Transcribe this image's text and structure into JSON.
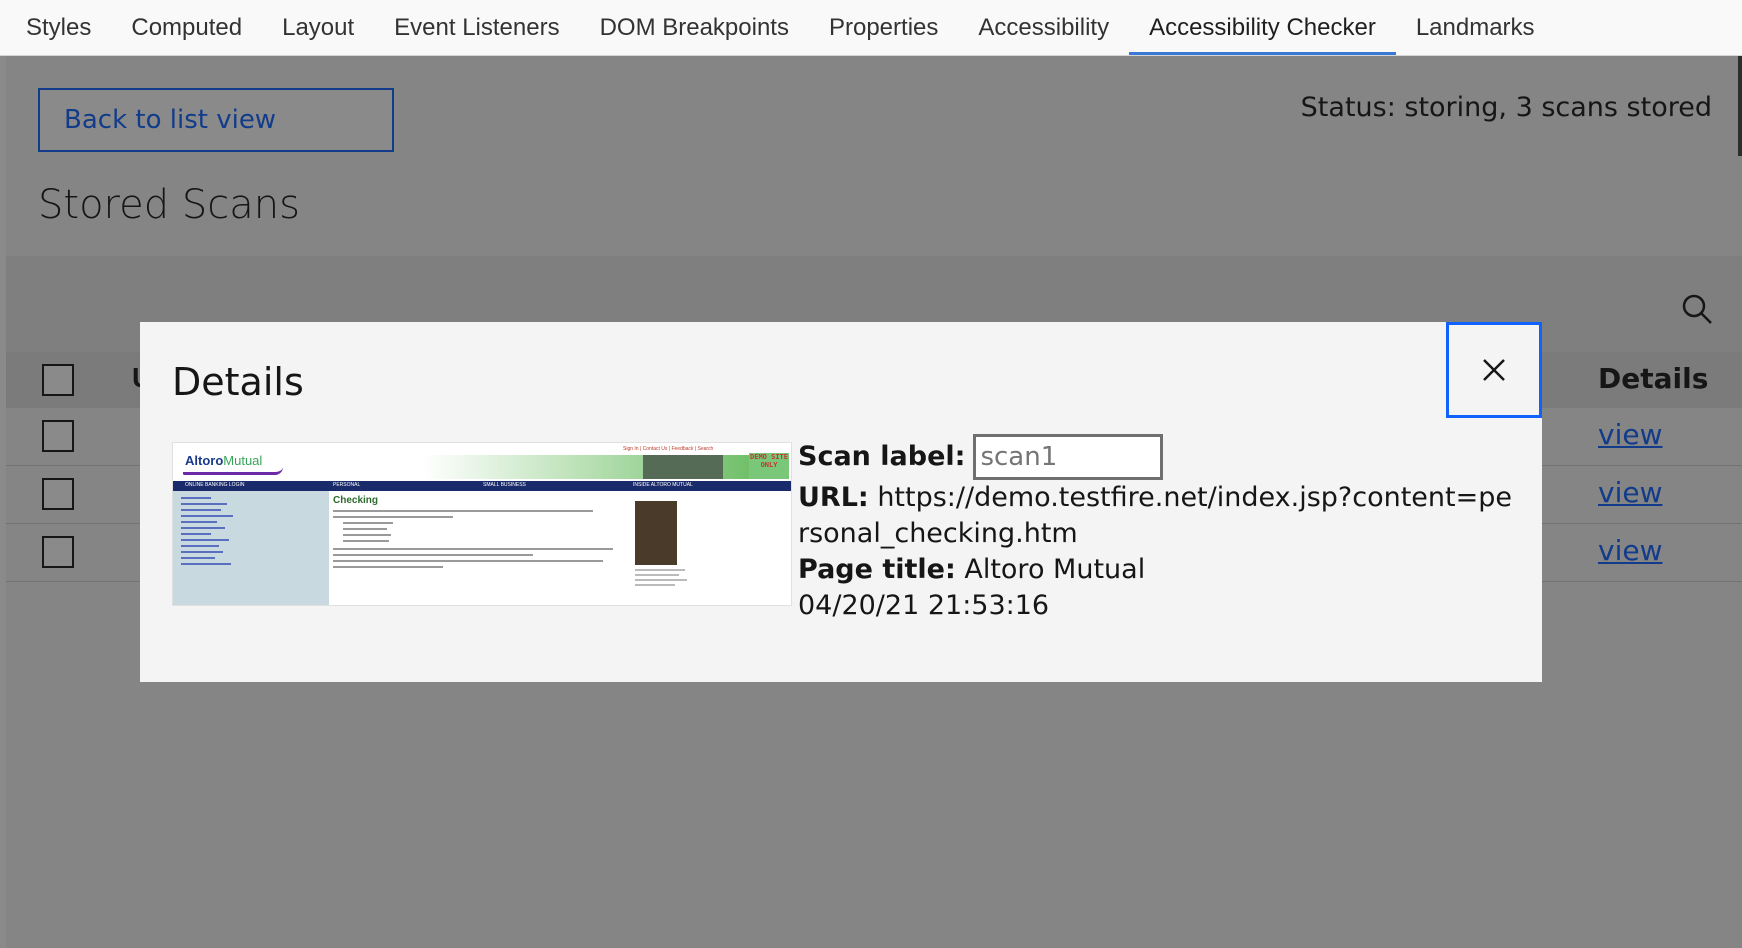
{
  "tabs": [
    {
      "label": "Styles"
    },
    {
      "label": "Computed"
    },
    {
      "label": "Layout"
    },
    {
      "label": "Event Listeners"
    },
    {
      "label": "DOM Breakpoints"
    },
    {
      "label": "Properties"
    },
    {
      "label": "Accessibility"
    },
    {
      "label": "Accessibility Checker",
      "active": true
    },
    {
      "label": "Landmarks"
    }
  ],
  "panel": {
    "back_button": "Back to list view",
    "status": "Status: storing, 3 scans stored",
    "title": "Stored Scans",
    "table": {
      "header_first_char": "U",
      "header_details": "Details",
      "rows": [
        {
          "link": "view"
        },
        {
          "link": "view"
        },
        {
          "link": "view"
        }
      ]
    }
  },
  "modal": {
    "title": "Details",
    "close_icon": "close-icon",
    "thumbnail": {
      "logo_bold": "Altoro",
      "logo_light": "Mutual",
      "heading": "Checking",
      "badge": "DEMO SITE ONLY",
      "nav": [
        "ONLINE BANKING LOGIN",
        "PERSONAL",
        "SMALL BUSINESS",
        "INSIDE ALTORO MUTUAL"
      ],
      "top_links": "Sign In | Contact Us | Feedback | Search"
    },
    "scan_label_label": "Scan label:",
    "scan_label_value": "scan1",
    "url_label": "URL:",
    "url_value": "https://demo.testfire.net/index.jsp?content=personal_checking.htm",
    "page_title_label": "Page title:",
    "page_title_value": "Altoro Mutual",
    "timestamp": "04/20/21 21:53:16"
  },
  "colors": {
    "accent": "#0f62fe",
    "overlay": "rgba(22,22,22,0.5)"
  }
}
